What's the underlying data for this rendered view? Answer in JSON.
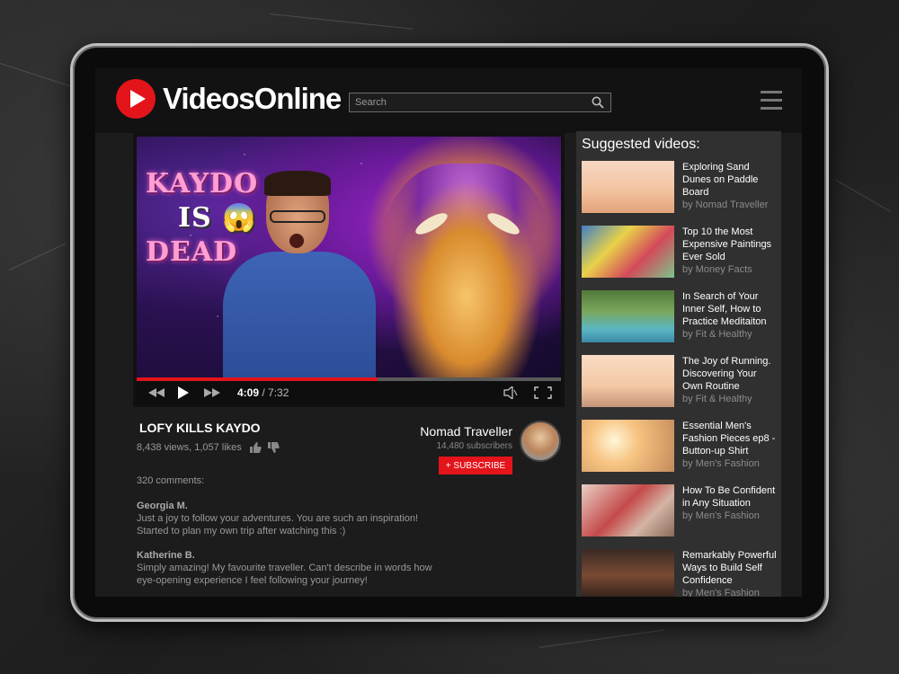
{
  "header": {
    "logo_text": "VideosOnline",
    "search_placeholder": "Search"
  },
  "player": {
    "thumbnail_text_1": "KAYDO",
    "thumbnail_text_2": "IS 😱",
    "thumbnail_text_3": "DEAD",
    "current_time": "4:09",
    "duration": "7:32",
    "progress_fraction": 0.567
  },
  "video": {
    "title": "LOFY KILLS KAYDO",
    "stats": "8,438 views, 1,057 likes",
    "channel_name": "Nomad Traveller",
    "subscribers": "14,480 subscribers",
    "subscribe_label": "+ SUBSCRIBE",
    "comments_count": "320 comments:"
  },
  "comments": [
    {
      "author": "Georgia M.",
      "text": "Just a joy to follow your adventures. You are such an inspiration! Started to plan my own trip after watching this :)"
    },
    {
      "author": "Katherine B.",
      "text": "Simply amazing! My favourite traveller. Can't describe in words how eye-opening experience I feel following your journey!"
    }
  ],
  "sidebar": {
    "title": "Suggested videos:",
    "items": [
      {
        "title": "Exploring Sand Dunes on Paddle Board",
        "channel": "by Nomad Traveller"
      },
      {
        "title": "Top 10 the Most Expensive Paintings Ever Sold",
        "channel": "by Money Facts"
      },
      {
        "title": "In Search of Your Inner Self, How to Practice Meditaiton",
        "channel": "by Fit & Healthy"
      },
      {
        "title": "The Joy of Running. Discovering Your Own Routine",
        "channel": "by Fit & Healthy"
      },
      {
        "title": "Essential Men's Fashion Pieces ep8 - Button-up Shirt",
        "channel": "by Men's Fashion"
      },
      {
        "title": "How To Be Confident in Any Situation",
        "channel": "by Men's Fashion"
      },
      {
        "title": "Remarkably Powerful Ways to Build Self Confidence",
        "channel": "by Men's Fashion"
      }
    ]
  },
  "colors": {
    "brand_red": "#e4141b",
    "background": "#1c1c1c",
    "sidebar_bg": "#303030"
  }
}
